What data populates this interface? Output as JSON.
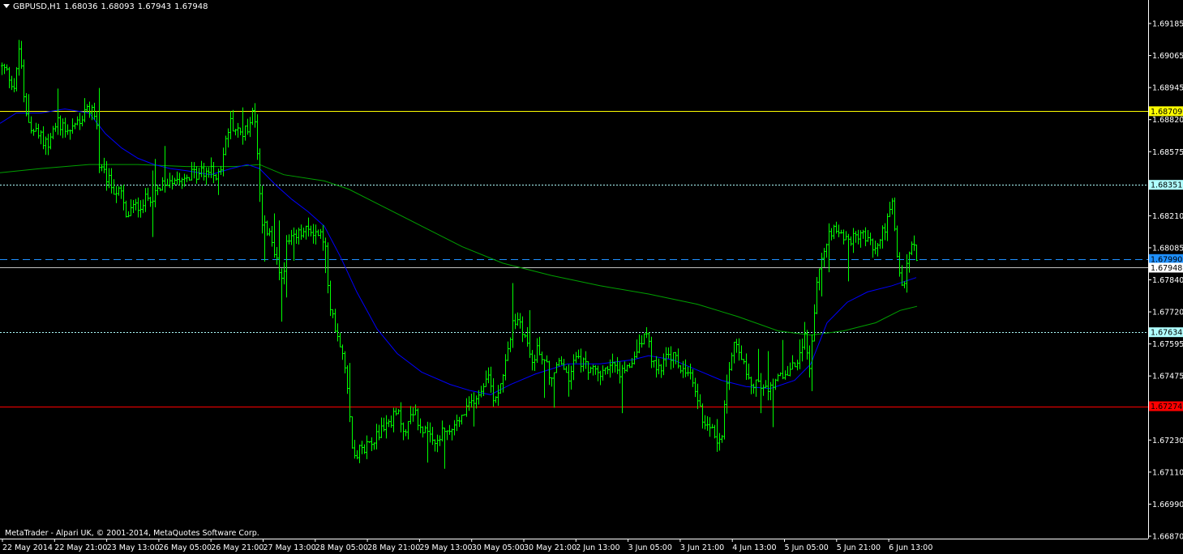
{
  "header": {
    "symbol": "GBPUSD,H1",
    "open": "1.68036",
    "high": "1.68093",
    "low": "1.67943",
    "close": "1.67948"
  },
  "footer": {
    "copyright": "MetaTrader - Alpari UK, © 2001-2014, MetaQuotes Software Corp."
  },
  "colors": {
    "background": "#000000",
    "candle": "#00FF00",
    "ma_fast": "#0000FF",
    "ma_slow": "#00A000",
    "support_line": "#FF0000",
    "resistance_line": "#FFFF00",
    "level_dotted": "#AFFFFF",
    "dashed_level": "#1E90FF",
    "bid_line": "#C0C0C0"
  },
  "chart_data": {
    "type": "candlestick",
    "ylim": [
      1.6663,
      1.6925
    ],
    "grid": false,
    "y_ticks": [
      "1.69185",
      "1.69065",
      "1.68945",
      "1.68820",
      "1.68575",
      "1.68455",
      "1.68210",
      "1.68085",
      "1.67840",
      "1.67720",
      "1.67595",
      "1.67475",
      "1.67350",
      "1.67230",
      "1.67110",
      "1.66990",
      "1.66870"
    ],
    "x_ticks": [
      "22 May 2014",
      "22 May 21:00",
      "23 May 13:00",
      "26 May 05:00",
      "26 May 21:00",
      "27 May 13:00",
      "28 May 05:00",
      "28 May 21:00",
      "29 May 13:00",
      "30 May 05:00",
      "30 May 21:00",
      "2 Jun 13:00",
      "3 Jun 05:00",
      "3 Jun 21:00",
      "4 Jun 13:00",
      "5 Jun 05:00",
      "5 Jun 21:00",
      "6 Jun 13:00"
    ],
    "levels": [
      {
        "label": "1.68709",
        "value": 1.68709,
        "style": "solid",
        "color": "#FFFF00",
        "tag_bg": "#FFFF00",
        "tag_fg": "#000000"
      },
      {
        "label": "1.68351",
        "value": 1.68351,
        "style": "dotted",
        "color": "#AFFFFF",
        "tag_bg": "#AFFFFF",
        "tag_fg": "#000000"
      },
      {
        "label": "1.67990",
        "value": 1.6799,
        "style": "dashed",
        "color": "#1E90FF",
        "tag_bg": "#1E90FF",
        "tag_fg": "#000000"
      },
      {
        "label": "1.67948",
        "value": 1.67948,
        "style": "solid",
        "color": "#C0C0C0",
        "tag_bg": "#FFFFFF",
        "tag_fg": "#000000"
      },
      {
        "label": "1.67634",
        "value": 1.67634,
        "style": "dotted",
        "color": "#AFFFFF",
        "tag_bg": "#AFFFFF",
        "tag_fg": "#000000"
      },
      {
        "label": "1.67274",
        "value": 1.67274,
        "style": "solid",
        "color": "#FF0000",
        "tag_bg": "#FF0000",
        "tag_fg": "#000000"
      }
    ],
    "price_path": [
      [
        0,
        1.6893
      ],
      [
        8,
        1.689
      ],
      [
        18,
        1.6882
      ],
      [
        24,
        1.6905
      ],
      [
        30,
        1.687
      ],
      [
        40,
        1.6862
      ],
      [
        50,
        1.6858
      ],
      [
        60,
        1.6855
      ],
      [
        70,
        1.6866
      ],
      [
        85,
        1.6862
      ],
      [
        100,
        1.6868
      ],
      [
        112,
        1.6872
      ],
      [
        118,
        1.687
      ],
      [
        122,
        1.6843
      ],
      [
        132,
        1.6838
      ],
      [
        140,
        1.6833
      ],
      [
        150,
        1.683
      ],
      [
        155,
        1.6818
      ],
      [
        160,
        1.6823
      ],
      [
        170,
        1.6825
      ],
      [
        180,
        1.6828
      ],
      [
        195,
        1.6832
      ],
      [
        210,
        1.6838
      ],
      [
        225,
        1.684
      ],
      [
        240,
        1.684
      ],
      [
        255,
        1.6842
      ],
      [
        270,
        1.684
      ],
      [
        283,
        1.6866
      ],
      [
        295,
        1.686
      ],
      [
        305,
        1.6862
      ],
      [
        312,
        1.6874
      ],
      [
        318,
        1.6848
      ],
      [
        322,
        1.6818
      ],
      [
        332,
        1.681
      ],
      [
        340,
        1.68
      ],
      [
        348,
        1.6787
      ],
      [
        352,
        1.6805
      ],
      [
        360,
        1.6808
      ],
      [
        372,
        1.6812
      ],
      [
        385,
        1.6813
      ],
      [
        397,
        1.681
      ],
      [
        402,
        1.6803
      ],
      [
        405,
        1.6775
      ],
      [
        412,
        1.6768
      ],
      [
        418,
        1.676
      ],
      [
        425,
        1.6748
      ],
      [
        430,
        1.673
      ],
      [
        434,
        1.6707
      ],
      [
        440,
        1.6705
      ],
      [
        450,
        1.6708
      ],
      [
        460,
        1.6712
      ],
      [
        470,
        1.6716
      ],
      [
        480,
        1.672
      ],
      [
        490,
        1.6724
      ],
      [
        500,
        1.6714
      ],
      [
        508,
        1.6727
      ],
      [
        515,
        1.672
      ],
      [
        525,
        1.6714
      ],
      [
        535,
        1.6708
      ],
      [
        545,
        1.6714
      ],
      [
        555,
        1.6715
      ],
      [
        565,
        1.672
      ],
      [
        575,
        1.6725
      ],
      [
        585,
        1.6732
      ],
      [
        593,
        1.6735
      ],
      [
        600,
        1.6745
      ],
      [
        608,
        1.6732
      ],
      [
        615,
        1.6735
      ],
      [
        625,
        1.6755
      ],
      [
        633,
        1.6768
      ],
      [
        640,
        1.677
      ],
      [
        648,
        1.676
      ],
      [
        655,
        1.675
      ],
      [
        663,
        1.6755
      ],
      [
        672,
        1.675
      ],
      [
        680,
        1.674
      ],
      [
        690,
        1.675
      ],
      [
        700,
        1.674
      ],
      [
        710,
        1.6752
      ],
      [
        720,
        1.6748
      ],
      [
        730,
        1.6745
      ],
      [
        740,
        1.6742
      ],
      [
        750,
        1.6748
      ],
      [
        760,
        1.6745
      ],
      [
        770,
        1.6742
      ],
      [
        780,
        1.675
      ],
      [
        790,
        1.676
      ],
      [
        797,
        1.6762
      ],
      [
        803,
        1.675
      ],
      [
        810,
        1.6745
      ],
      [
        820,
        1.675
      ],
      [
        830,
        1.6752
      ],
      [
        840,
        1.6745
      ],
      [
        850,
        1.6742
      ],
      [
        858,
        1.6735
      ],
      [
        865,
        1.6722
      ],
      [
        875,
        1.6718
      ],
      [
        885,
        1.671
      ],
      [
        890,
        1.6715
      ],
      [
        895,
        1.674
      ],
      [
        900,
        1.6748
      ],
      [
        905,
        1.676
      ],
      [
        912,
        1.6755
      ],
      [
        918,
        1.6745
      ],
      [
        925,
        1.674
      ],
      [
        935,
        1.6738
      ],
      [
        945,
        1.6736
      ],
      [
        955,
        1.674
      ],
      [
        965,
        1.6742
      ],
      [
        975,
        1.6745
      ],
      [
        985,
        1.675
      ],
      [
        992,
        1.676
      ],
      [
        998,
        1.6748
      ],
      [
        1003,
        1.677
      ],
      [
        1008,
        1.679
      ],
      [
        1015,
        1.68
      ],
      [
        1022,
        1.6812
      ],
      [
        1030,
        1.6815
      ],
      [
        1040,
        1.681
      ],
      [
        1050,
        1.6808
      ],
      [
        1060,
        1.6812
      ],
      [
        1070,
        1.6808
      ],
      [
        1080,
        1.6803
      ],
      [
        1088,
        1.6812
      ],
      [
        1094,
        1.6818
      ],
      [
        1100,
        1.6825
      ],
      [
        1104,
        1.6808
      ],
      [
        1108,
        1.6792
      ],
      [
        1114,
        1.6785
      ],
      [
        1120,
        1.68
      ],
      [
        1126,
        1.6808
      ],
      [
        1131,
        1.6795
      ]
    ],
    "ma_fast_path": [
      [
        0,
        1.6865
      ],
      [
        20,
        1.687
      ],
      [
        50,
        1.687
      ],
      [
        80,
        1.6872
      ],
      [
        110,
        1.687
      ],
      [
        130,
        1.686
      ],
      [
        150,
        1.6853
      ],
      [
        170,
        1.6848
      ],
      [
        190,
        1.6845
      ],
      [
        210,
        1.6843
      ],
      [
        230,
        1.6842
      ],
      [
        260,
        1.684
      ],
      [
        285,
        1.6843
      ],
      [
        305,
        1.6845
      ],
      [
        320,
        1.6843
      ],
      [
        340,
        1.6835
      ],
      [
        360,
        1.6828
      ],
      [
        380,
        1.6822
      ],
      [
        400,
        1.6815
      ],
      [
        420,
        1.68
      ],
      [
        440,
        1.6783
      ],
      [
        465,
        1.6765
      ],
      [
        490,
        1.6753
      ],
      [
        520,
        1.6744
      ],
      [
        555,
        1.6738
      ],
      [
        580,
        1.6735
      ],
      [
        605,
        1.6733
      ],
      [
        630,
        1.6738
      ],
      [
        660,
        1.6743
      ],
      [
        700,
        1.6748
      ],
      [
        740,
        1.6748
      ],
      [
        780,
        1.675
      ],
      [
        800,
        1.6752
      ],
      [
        830,
        1.675
      ],
      [
        860,
        1.6745
      ],
      [
        890,
        1.674
      ],
      [
        920,
        1.6737
      ],
      [
        950,
        1.6736
      ],
      [
        980,
        1.674
      ],
      [
        1000,
        1.6748
      ],
      [
        1020,
        1.6768
      ],
      [
        1045,
        1.6778
      ],
      [
        1070,
        1.6783
      ],
      [
        1100,
        1.6786
      ],
      [
        1130,
        1.679
      ]
    ],
    "ma_slow_path": [
      [
        0,
        1.6841
      ],
      [
        50,
        1.6843
      ],
      [
        110,
        1.6845
      ],
      [
        170,
        1.6845
      ],
      [
        230,
        1.6844
      ],
      [
        290,
        1.6844
      ],
      [
        320,
        1.6845
      ],
      [
        350,
        1.684
      ],
      [
        400,
        1.6837
      ],
      [
        430,
        1.6833
      ],
      [
        470,
        1.6825
      ],
      [
        520,
        1.6815
      ],
      [
        570,
        1.6805
      ],
      [
        620,
        1.6797
      ],
      [
        680,
        1.6791
      ],
      [
        740,
        1.6786
      ],
      [
        800,
        1.6782
      ],
      [
        860,
        1.6777
      ],
      [
        910,
        1.6771
      ],
      [
        960,
        1.6764
      ],
      [
        1000,
        1.6762
      ],
      [
        1040,
        1.6764
      ],
      [
        1080,
        1.6768
      ],
      [
        1110,
        1.6774
      ],
      [
        1131,
        1.6776
      ]
    ]
  }
}
